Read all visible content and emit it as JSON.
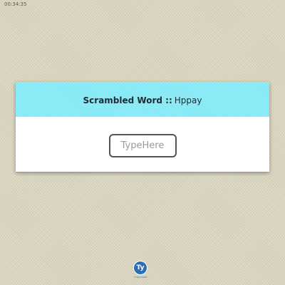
{
  "timer": "00:34:35",
  "word_card": {
    "label": "Scrambled Word ::",
    "scrambled_word": "Hppay"
  },
  "answer_input": {
    "placeholder": "TypeHere",
    "value": ""
  },
  "logo": {
    "mark": "Ty",
    "caption": "TYPEYOURS"
  },
  "colors": {
    "page_background": "#d9d5bf",
    "header_accent": "#86e9f6",
    "input_border": "#555555"
  }
}
